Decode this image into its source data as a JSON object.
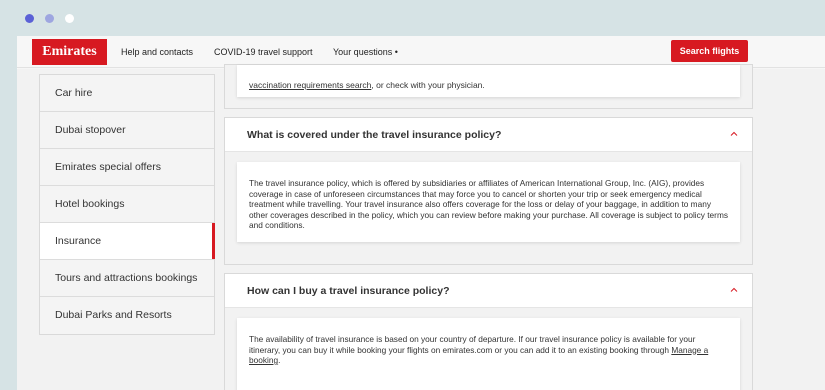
{
  "nav": {
    "logo": "Emirates",
    "links": [
      "Help and contacts",
      "COVID-19 travel support",
      "Your questions •"
    ],
    "search_button": "Search flights"
  },
  "sidebar": {
    "items": [
      {
        "label": "Car hire",
        "active": false
      },
      {
        "label": "Dubai stopover",
        "active": false
      },
      {
        "label": "Emirates special offers",
        "active": false
      },
      {
        "label": "Hotel bookings",
        "active": false
      },
      {
        "label": "Insurance",
        "active": true
      },
      {
        "label": "Tours and attractions bookings",
        "active": false
      },
      {
        "label": "Dubai Parks and Resorts",
        "active": false
      }
    ]
  },
  "top_snippet": {
    "link": "vaccination requirements search",
    "text": ", or check with your physician."
  },
  "faqs": [
    {
      "question": "What is covered under the travel insurance policy?",
      "answer": "The travel insurance policy, which is offered by subsidiaries or affiliates of American International Group, Inc. (AIG), provides coverage in case of unforeseen circumstances that may force you to cancel or shorten your trip or seek emergency medical treatment while travelling. Your travel insurance also offers coverage for the loss or delay of your baggage, in addition to many other coverages described in the policy, which you can review before making your purchase. All coverage is subject to policy terms and conditions."
    },
    {
      "question": "How can I buy a travel insurance policy?",
      "answer": "The availability of travel insurance is based on your country of departure. If our travel insurance policy is available for your itinerary, you can buy it while booking your flights on emirates.com or you can add it to an existing booking through ",
      "answer_link": "Manage a booking",
      "answer_end": "."
    }
  ],
  "colors": {
    "brand_red": "#d71921",
    "background": "#d6e3e5",
    "window_dots": [
      "#5b61d6",
      "#9ea6e0",
      "#ffffff"
    ]
  }
}
